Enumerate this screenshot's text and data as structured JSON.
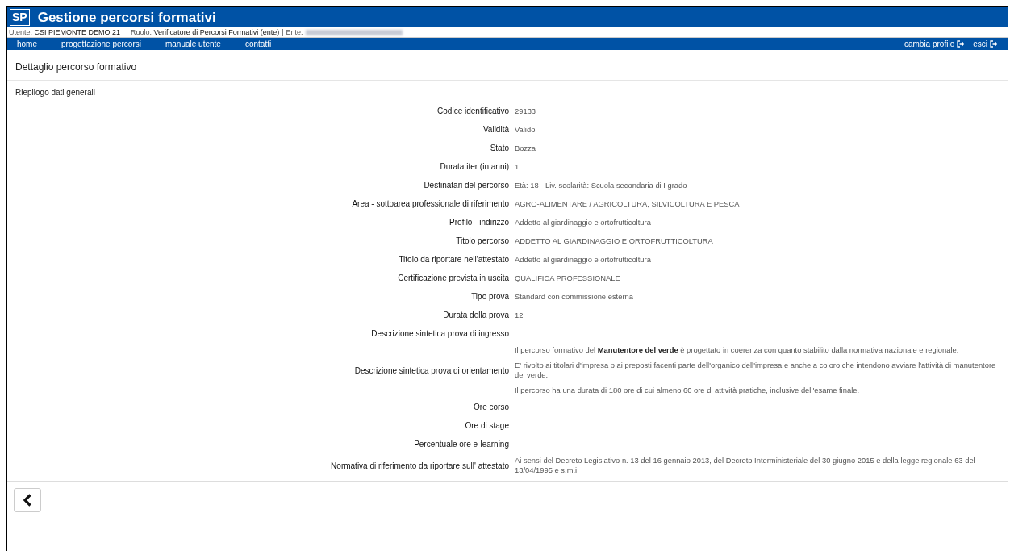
{
  "header": {
    "logo": "SP",
    "title": "Gestione percorsi formativi"
  },
  "user_bar": {
    "user_label": "Utente:",
    "user": "CSI PIEMONTE DEMO 21",
    "role_label": "Ruolo:",
    "role": "Verificatore di Percorsi Formativi (ente)",
    "separator": "|",
    "ente_label": "Ente:",
    "ente_redacted": true
  },
  "nav": {
    "items": [
      {
        "label": "home"
      },
      {
        "label": "progettazione percorsi"
      },
      {
        "label": "manuale utente"
      },
      {
        "label": "contatti"
      }
    ],
    "right_items": [
      {
        "label": "cambia profilo"
      },
      {
        "label": "esci"
      }
    ]
  },
  "page_title": "Dettaglio percorso formativo",
  "section_title": "Riepilogo dati generali",
  "fields": [
    {
      "label": "Codice identificativo",
      "value": [
        "29133"
      ]
    },
    {
      "label": "Validità",
      "value": [
        "Valido"
      ]
    },
    {
      "label": "Stato",
      "value": [
        "Bozza"
      ]
    },
    {
      "label": "Durata iter (in anni)",
      "value": [
        "1"
      ]
    },
    {
      "label": "Destinatari del percorso",
      "value": [
        "Età: 18 - Liv. scolarità: Scuola secondaria di I grado"
      ]
    },
    {
      "label": "Area - sottoarea professionale di riferimento",
      "value": [
        "AGRO-ALIMENTARE / AGRICOLTURA, SILVICOLTURA E PESCA"
      ]
    },
    {
      "label": "Profilo - indirizzo",
      "value": [
        "Addetto al giardinaggio e ortofrutticoltura"
      ]
    },
    {
      "label": "Titolo percorso",
      "value": [
        "ADDETTO AL GIARDINAGGIO E ORTOFRUTTICOLTURA"
      ]
    },
    {
      "label": "Titolo da riportare nell'attestato",
      "value": [
        "Addetto al giardinaggio e ortofrutticoltura"
      ]
    },
    {
      "label": "Certificazione prevista in uscita",
      "value": [
        "QUALIFICA PROFESSIONALE"
      ]
    },
    {
      "label": "Tipo prova",
      "value": [
        "Standard con commissione esterna"
      ]
    },
    {
      "label": "Durata della prova",
      "value": [
        "12"
      ]
    },
    {
      "label": "Descrizione sintetica prova di ingresso"
    },
    {
      "label": "Descrizione sintetica prova di orientamento",
      "value": [
        "Il percorso formativo del **Manutentore del verde** è progettato in coerenza con quanto stabilito dalla normativa nazionale e regionale.",
        "E' rivolto ai titolari d'impresa o ai preposti facenti parte dell'organico dell'impresa e anche a coloro che intendono avviare l'attività di manutentore del verde.",
        "Il percorso ha una durata di 180 ore di cui almeno 60 ore di attività pratiche, inclusive dell'esame finale."
      ]
    },
    {
      "label": "Ore corso"
    },
    {
      "label": "Ore di stage"
    },
    {
      "label": "Percentuale ore e-learning"
    },
    {
      "label": "Normativa di riferimento da riportare sull' attestato",
      "value": [
        "Ai sensi del Decreto Legislativo n. 13 del 16 gennaio 2013, del Decreto Interministeriale del 30 giugno 2015 e della legge regionale 63 del 13/04/1995 e s.m.i."
      ]
    }
  ]
}
